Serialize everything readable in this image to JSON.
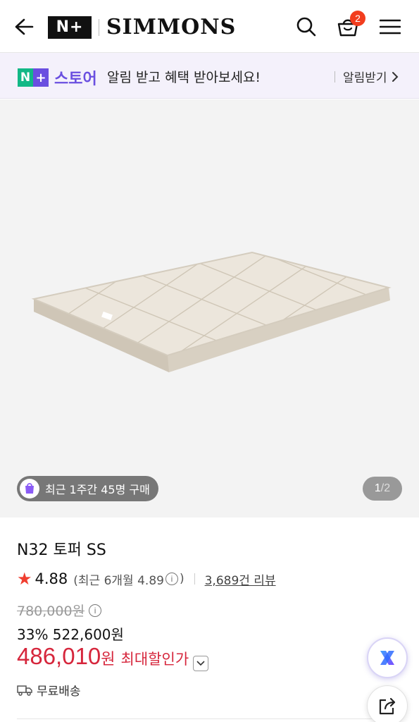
{
  "header": {
    "logo_badge": "N+",
    "brand_name": "SIMMONS",
    "cart_count": "2",
    "icons": [
      "arrow-left-icon",
      "search-icon",
      "cart-icon",
      "hamburger-menu-icon"
    ]
  },
  "banner": {
    "store_n": "N",
    "store_plus": "+",
    "store_word": "스토어",
    "message": "알림 받고 혜택 받아보세요!",
    "link_label": "알림받기"
  },
  "gallery": {
    "recent_purchase": "최근 1주간 45명 구매",
    "page_current": "1",
    "page_sep": " / ",
    "page_total": "2"
  },
  "product": {
    "title": "N32 토퍼 SS",
    "rating": "4.88",
    "recent_rating": "(최근 6개월 4.89",
    "recent_rating_close": ")",
    "reviews": "3,689건 리뷰",
    "original_price": "780,000원",
    "discount": "33% 522,600원",
    "final_price": "486,010",
    "final_won": "원",
    "final_label": "최대할인가",
    "shipping": "무료배송"
  },
  "colors": {
    "accent_red": "#d6263c",
    "naver_green": "#12b886",
    "store_purple": "#6a4fe0",
    "cart_badge": "#f23d1e"
  }
}
